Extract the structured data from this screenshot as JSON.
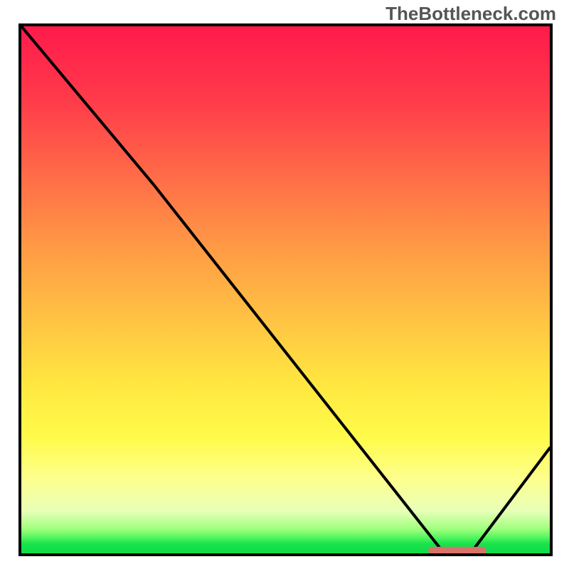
{
  "attribution": "TheBottleneck.com",
  "chart_data": {
    "type": "line",
    "title": "",
    "xlabel": "",
    "ylabel": "",
    "xlim": [
      0,
      100
    ],
    "ylim": [
      0,
      100
    ],
    "series": [
      {
        "name": "bottleneck-curve",
        "x": [
          0,
          25,
          80,
          85,
          100
        ],
        "y": [
          100,
          70,
          0,
          0,
          20
        ]
      }
    ],
    "marker": {
      "name": "optimal-range",
      "x_start": 77,
      "x_end": 88,
      "y": 0.6,
      "color": "#d9726c"
    },
    "gradient_stops": [
      {
        "pos": 0,
        "meaning": "worst",
        "color": "#ff1a4b"
      },
      {
        "pos": 68,
        "meaning": "mid",
        "color": "#ffe740"
      },
      {
        "pos": 100,
        "meaning": "best",
        "color": "#11db4b"
      }
    ]
  }
}
